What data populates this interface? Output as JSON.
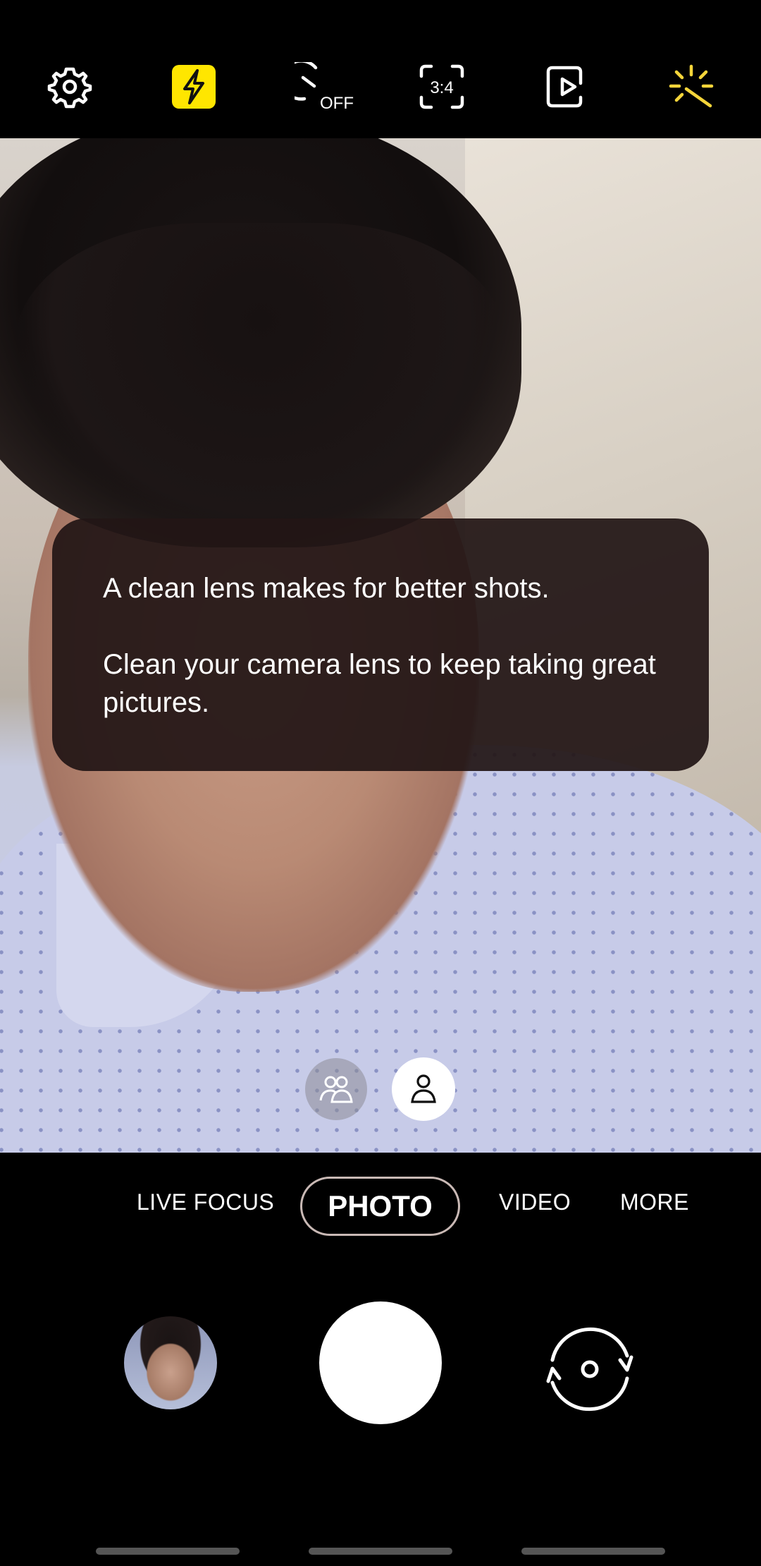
{
  "topbar": {
    "buttons": [
      {
        "name": "settings",
        "icon": "gear-icon"
      },
      {
        "name": "flash",
        "icon": "flash-icon",
        "active": true,
        "accent": "#ffe600"
      },
      {
        "name": "timer",
        "icon": "timer-icon",
        "label": "OFF"
      },
      {
        "name": "ratio",
        "icon": "aspect-ratio-icon",
        "label": "3:4"
      },
      {
        "name": "motion-photo",
        "icon": "motion-photo-icon"
      },
      {
        "name": "filters",
        "icon": "sparkle-icon",
        "accent": "#f5d53a"
      }
    ]
  },
  "toast": {
    "line1": "A clean lens makes for better shots.",
    "line2": "Clean your camera lens to keep taking great pictures."
  },
  "selfie_modes": [
    {
      "name": "group-selfie",
      "icon": "group-people-icon",
      "selected": false
    },
    {
      "name": "single-selfie",
      "icon": "person-icon",
      "selected": true
    }
  ],
  "modes": {
    "live_focus": "LIVE FOCUS",
    "photo": "PHOTO",
    "video": "VIDEO",
    "more": "MORE",
    "selected": "PHOTO"
  },
  "controls": {
    "gallery_icon": "gallery-thumbnail",
    "shutter_icon": "shutter-button",
    "flip_icon": "switch-camera-icon"
  }
}
